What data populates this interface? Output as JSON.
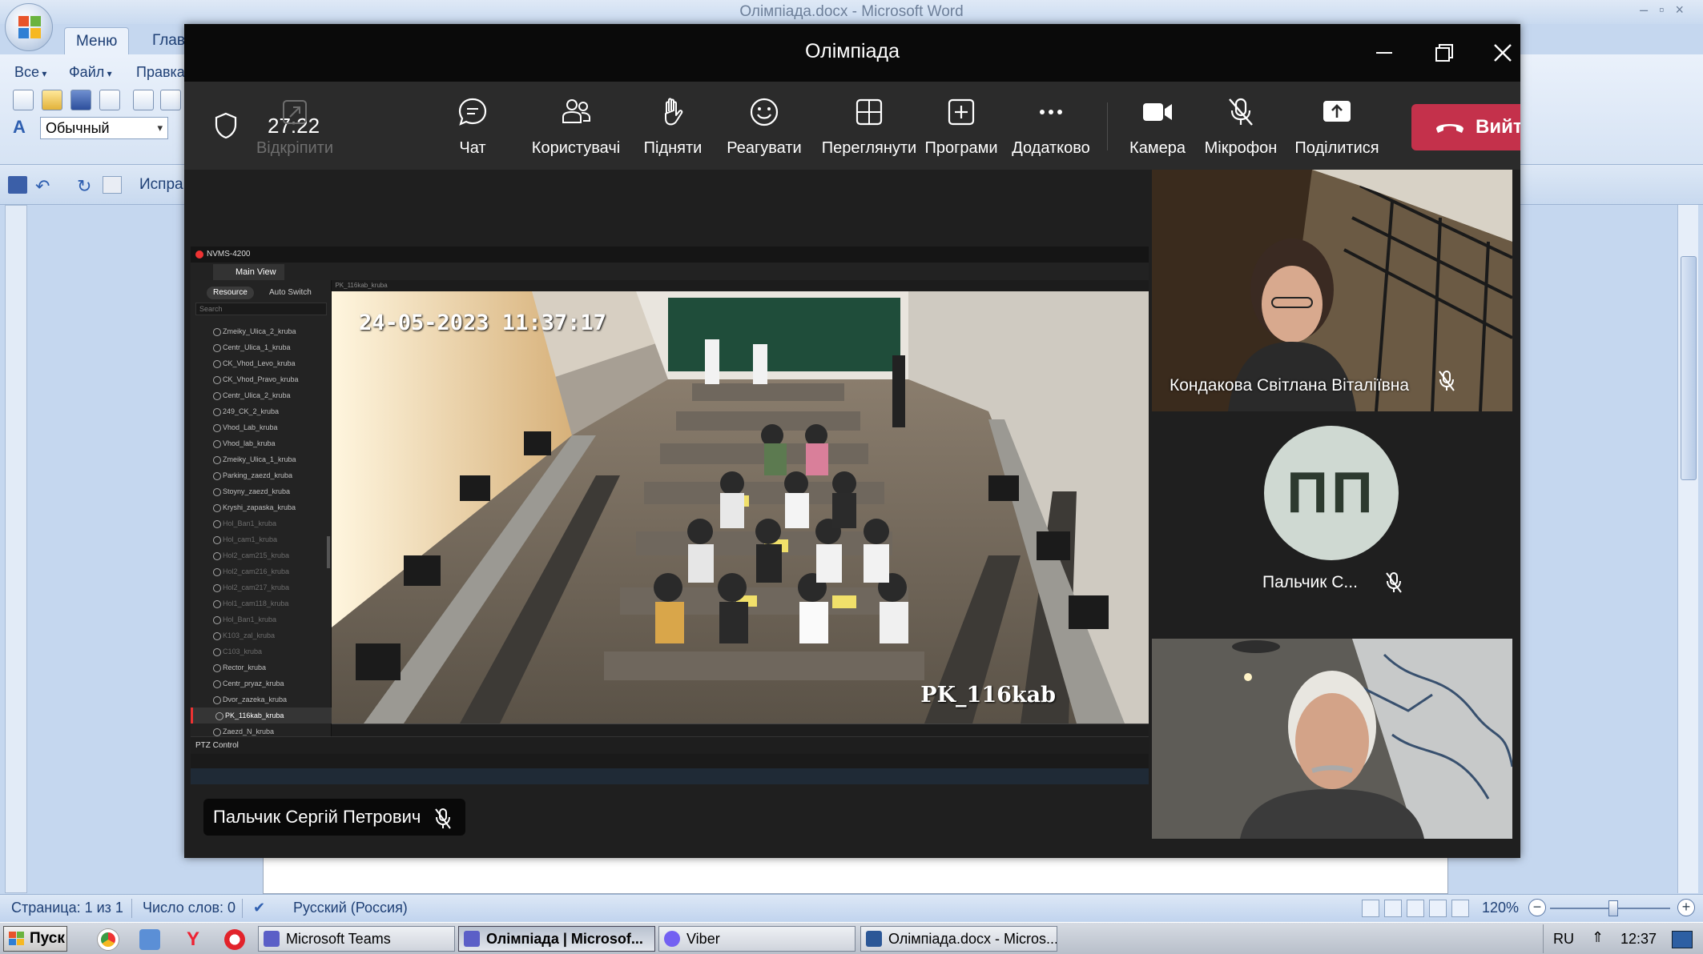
{
  "word": {
    "window_title": "Олімпіада.docx - Microsoft Word",
    "ribbon_tabs": [
      "Меню",
      "Главн"
    ],
    "menu": [
      "Все",
      "Файл",
      "Правка"
    ],
    "style_value": "Обычный",
    "qat_edit_label": "Испра",
    "status": {
      "page": "Страница: 1 из 1",
      "words": "Число слов: 0",
      "language": "Русский (Россия)",
      "zoom": "120%"
    }
  },
  "taskbar": {
    "start_label": "Пуск",
    "tasks": [
      {
        "label": "Microsoft Teams",
        "active": false
      },
      {
        "label": "Олімпіада | Microsof...",
        "active": true
      },
      {
        "label": "Viber",
        "active": false
      },
      {
        "label": "Олімпіада.docx - Micros...",
        "active": false
      }
    ],
    "lang": "RU",
    "clock": "12:37"
  },
  "teams": {
    "meeting_title": "Олімпіада",
    "timer": "27:22",
    "toolbar": {
      "unpin": "Відкріпити",
      "chat": "Чат",
      "people": "Користувачі",
      "raise": "Підняти",
      "react": "Реагувати",
      "view": "Переглянути",
      "apps": "Програми",
      "more": "Додатково",
      "camera": "Камера",
      "mic": "Мікрофон",
      "share": "Поділитися",
      "leave": "Вийти"
    },
    "presenter_name": "Пальчик Сергій Петрович",
    "participants": [
      {
        "name": "Кондакова Світлана Віталіївна",
        "muted": true
      },
      {
        "name": "Пальчик С...",
        "initials": "ПП",
        "muted": true
      },
      {
        "name": "",
        "muted": false
      }
    ]
  },
  "nvr": {
    "app_name": "NVMS-4200",
    "main_tab": "Main View",
    "side_tabs": [
      "Resource",
      "Auto Switch"
    ],
    "search_placeholder": "Search",
    "view_header": "PK_116kab_kruba",
    "osd_timestamp": "24-05-2023 11:37:17",
    "osd_camera": "PK_116kab",
    "ptz_label": "PTZ Control",
    "cameras": [
      {
        "name": "Zmeiky_Ulica_2_kruba",
        "state": "on"
      },
      {
        "name": "Centr_Ulica_1_kruba",
        "state": "on"
      },
      {
        "name": "CK_Vhod_Levo_kruba",
        "state": "on"
      },
      {
        "name": "CK_Vhod_Pravo_kruba",
        "state": "on"
      },
      {
        "name": "Centr_Ulica_2_kruba",
        "state": "on"
      },
      {
        "name": "249_CK_2_kruba",
        "state": "on"
      },
      {
        "name": "Vhod_Lab_kruba",
        "state": "on"
      },
      {
        "name": "Vhod_lab_kruba",
        "state": "on"
      },
      {
        "name": "Zmeiky_Ulica_1_kruba",
        "state": "on"
      },
      {
        "name": "Parking_zaezd_kruba",
        "state": "on"
      },
      {
        "name": "Stoyny_zaezd_kruba",
        "state": "on"
      },
      {
        "name": "Kryshi_zapaska_kruba",
        "state": "on"
      },
      {
        "name": "Hol_Ban1_kruba",
        "state": "off"
      },
      {
        "name": "Hol_cam1_kruba",
        "state": "off"
      },
      {
        "name": "Hol2_cam215_kruba",
        "state": "off"
      },
      {
        "name": "Hol2_cam216_kruba",
        "state": "off"
      },
      {
        "name": "Hol2_cam217_kruba",
        "state": "off"
      },
      {
        "name": "Hol1_cam118_kruba",
        "state": "off"
      },
      {
        "name": "Hol_Ban1_kruba",
        "state": "off"
      },
      {
        "name": "K103_zal_kruba",
        "state": "off"
      },
      {
        "name": "C103_kruba",
        "state": "off"
      },
      {
        "name": "Rector_kruba",
        "state": "on"
      },
      {
        "name": "Centr_pryaz_kruba",
        "state": "on"
      },
      {
        "name": "Dvor_zazeka_kruba",
        "state": "on"
      },
      {
        "name": "PK_116kab_kruba",
        "state": "selected"
      },
      {
        "name": "Zaezd_N_kruba",
        "state": "on"
      }
    ]
  }
}
